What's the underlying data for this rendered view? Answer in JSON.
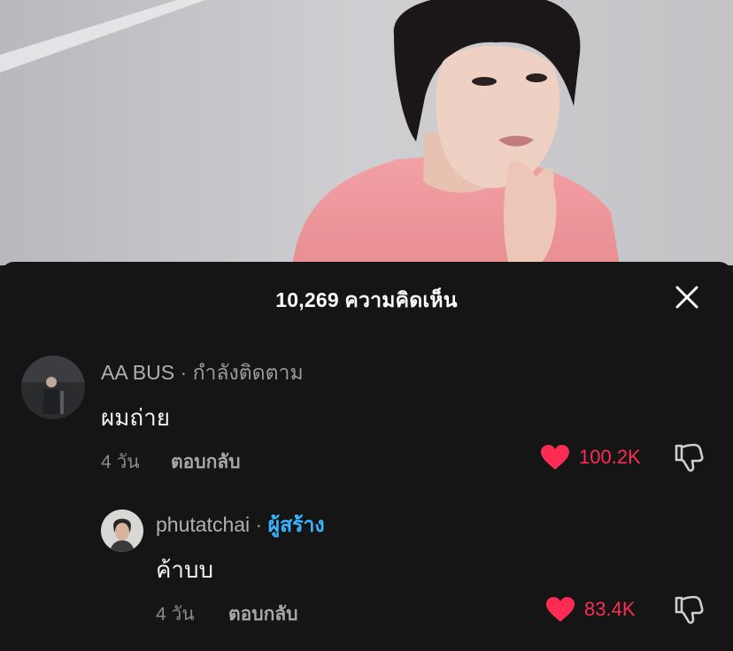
{
  "sheet": {
    "title": "10,269 ความคิดเห็น"
  },
  "colors": {
    "sheet_bg": "#151515",
    "like_red": "#fe2c55",
    "creator_blue": "#3bb4ff"
  },
  "comments": [
    {
      "author": "AA BUS",
      "separator": " · ",
      "tag": "กำลังติดตาม",
      "text": "ผมถ่าย",
      "time": "4 วัน",
      "reply_label": "ตอบกลับ",
      "likes": "100.2K",
      "liked": true
    },
    {
      "author": "phutatchai",
      "separator": " · ",
      "tag": "ผู้สร้าง",
      "text": "ค้าบบ",
      "time": "4 วัน",
      "reply_label": "ตอบกลับ",
      "likes": "83.4K",
      "liked": true
    }
  ],
  "icons": {
    "close": "close-icon",
    "like": "heart-icon",
    "dislike": "thumbs-down-icon"
  }
}
